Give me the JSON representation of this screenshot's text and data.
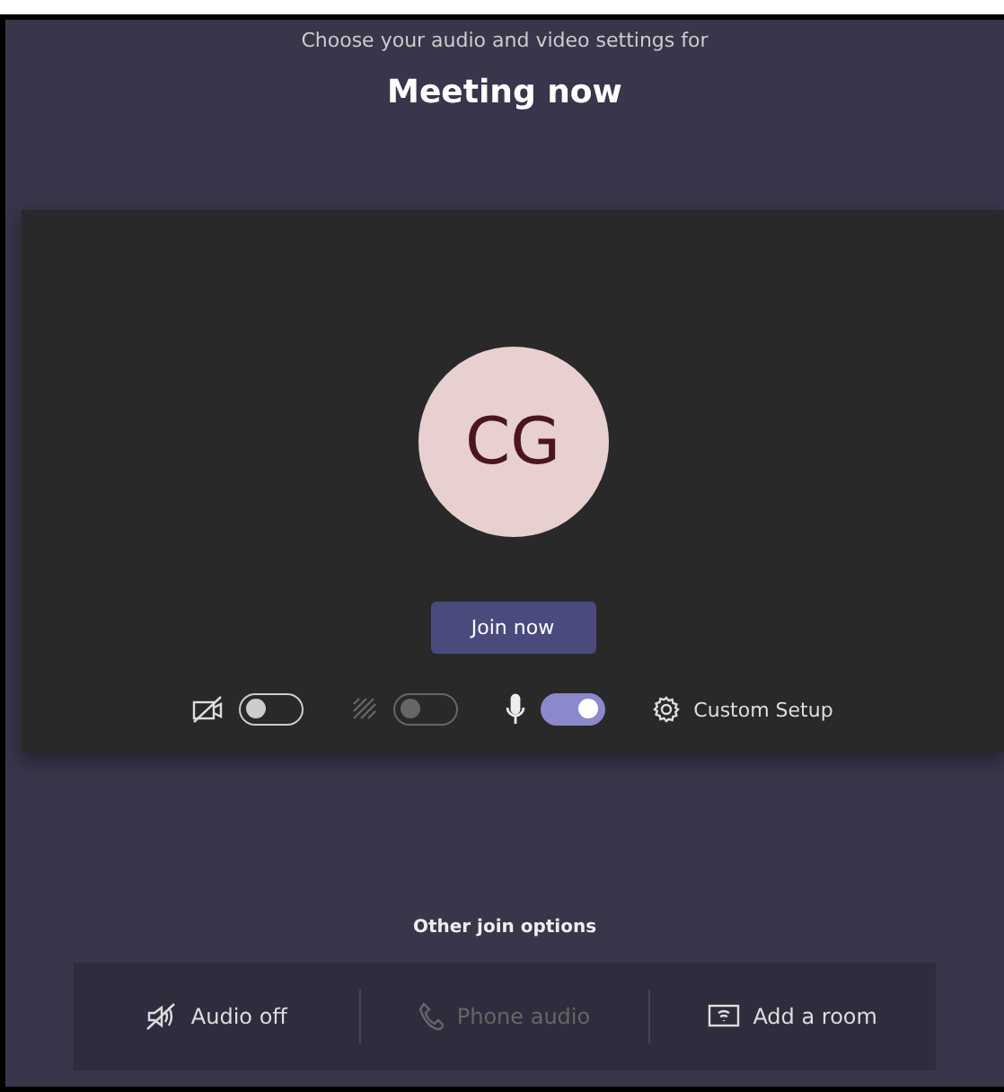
{
  "header": {
    "subtitle": "Choose your audio and video settings for",
    "title": "Meeting now"
  },
  "avatar": {
    "initials": "CG"
  },
  "join_button": "Join now",
  "toggles": [
    {
      "kind": "camera",
      "on": false,
      "disabled": false
    },
    {
      "kind": "blur",
      "on": false,
      "disabled": true
    },
    {
      "kind": "mic",
      "on": true,
      "disabled": false
    }
  ],
  "custom_setup": "Custom Setup",
  "other_options": {
    "title": "Other join options",
    "items": [
      {
        "kind": "audio-off",
        "label": "Audio off",
        "disabled": false
      },
      {
        "kind": "phone",
        "label": "Phone audio",
        "disabled": true
      },
      {
        "kind": "room",
        "label": "Add a room",
        "disabled": false
      }
    ]
  }
}
